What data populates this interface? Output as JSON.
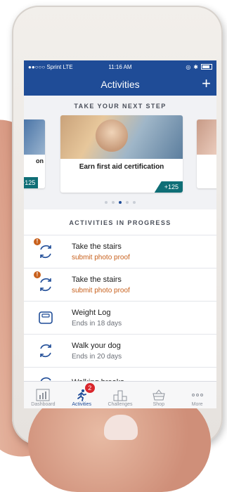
{
  "status_bar": {
    "carrier": "●●○○○ Sprint  LTE",
    "time": "11:16 AM"
  },
  "header": {
    "title": "Activities",
    "add_label": "+"
  },
  "next_step": {
    "title": "TAKE YOUR NEXT STEP",
    "cards": [
      {
        "title": "on",
        "points": "+125"
      },
      {
        "title": "Earn first aid certification",
        "points": "+125"
      },
      {
        "title": "",
        "points": ""
      }
    ],
    "active_dot": 2
  },
  "in_progress": {
    "title": "ACTIVITIES IN PROGRESS",
    "items": [
      {
        "name": "Take the stairs",
        "sub": "submit photo proof",
        "icon": "refresh-icon",
        "alert": "!"
      },
      {
        "name": "Take the stairs",
        "sub": "submit photo proof",
        "icon": "refresh-icon",
        "alert": "!"
      },
      {
        "name": "Weight Log",
        "sub": "Ends in 18 days",
        "icon": "scale-icon"
      },
      {
        "name": "Walk your dog",
        "sub": "Ends in 20 days",
        "icon": "refresh-icon"
      },
      {
        "name": "Walking breaks",
        "sub": "",
        "icon": "refresh-icon"
      }
    ]
  },
  "tabs": [
    {
      "label": "Dashboard",
      "icon": "chart-icon"
    },
    {
      "label": "Activities",
      "icon": "runner-icon",
      "badge": "2"
    },
    {
      "label": "Challenges",
      "icon": "podium-icon"
    },
    {
      "label": "Shop",
      "icon": "basket-icon"
    },
    {
      "label": "More",
      "icon": "more-icon"
    }
  ],
  "colors": {
    "brand": "#1f4c97",
    "accent": "#c8601c",
    "points": "#0f6e76",
    "badge": "#d9262c"
  }
}
